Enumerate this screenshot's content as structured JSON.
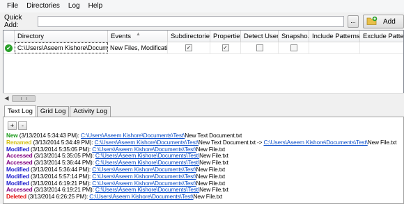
{
  "menu": [
    "File",
    "Directories",
    "Log",
    "Help"
  ],
  "quick_add": {
    "label": "Quick Add:",
    "value": "",
    "browse_label": "...",
    "add_label": "Add"
  },
  "grid": {
    "columns": [
      "Directory",
      "Events",
      "Subdirectories",
      "Properties",
      "Detect Users",
      "Snapsho...",
      "Include Patterns",
      "Exclude Patterns"
    ],
    "rows": [
      {
        "directory": "C:\\Users\\Aseem Kishore\\Docume...",
        "events": "New Files, Modificatio...",
        "subdirectories": true,
        "properties": true,
        "detect_users": false,
        "snapshot": false,
        "include": "",
        "exclude": ""
      }
    ]
  },
  "tabs": [
    "Text Log",
    "Grid Log",
    "Activity Log"
  ],
  "log_buttons": [
    "+",
    "-"
  ],
  "colors": {
    "new": "#1a9a1a",
    "renamed": "#d4c018",
    "modified": "#1a1acc",
    "accessed": "#800080",
    "deleted": "#e01010",
    "link": "#0b4ec9"
  },
  "log": [
    {
      "event": "New",
      "color": "#1a9a1a",
      "time": " (3/13/2014 5:34:43 PM): ",
      "link": "C:\\Users\\Aseem Kishore\\Documents\\Test\\",
      "rest": "New Text Document.txt",
      "link2": "",
      "rest2": ""
    },
    {
      "event": "Renamed",
      "color": "#d4c018",
      "time": " (3/13/2014 5:34:49 PM): ",
      "link": "C:\\Users\\Aseem Kishore\\Documents\\Test\\",
      "rest": "New Text Document.txt -> ",
      "link2": "C:\\Users\\Aseem Kishore\\Documents\\Test\\",
      "rest2": "New File.txt"
    },
    {
      "event": "Modified",
      "color": "#1a1acc",
      "time": " (3/13/2014 5:35:05 PM): ",
      "link": "C:\\Users\\Aseem Kishore\\Documents\\Test\\",
      "rest": "New File.txt",
      "link2": "",
      "rest2": ""
    },
    {
      "event": "Accessed",
      "color": "#800080",
      "time": " (3/13/2014 5:35:05 PM): ",
      "link": "C:\\Users\\Aseem Kishore\\Documents\\Test\\",
      "rest": "New File.txt",
      "link2": "",
      "rest2": ""
    },
    {
      "event": "Accessed",
      "color": "#800080",
      "time": " (3/13/2014 5:36:44 PM): ",
      "link": "C:\\Users\\Aseem Kishore\\Documents\\Test\\",
      "rest": "New File.txt",
      "link2": "",
      "rest2": ""
    },
    {
      "event": "Modified",
      "color": "#1a1acc",
      "time": " (3/13/2014 5:36:44 PM): ",
      "link": "C:\\Users\\Aseem Kishore\\Documents\\Test\\",
      "rest": "New File.txt",
      "link2": "",
      "rest2": ""
    },
    {
      "event": "Modified",
      "color": "#1a1acc",
      "time": " (3/13/2014 5:57:14 PM): ",
      "link": "C:\\Users\\Aseem Kishore\\Documents\\Test\\",
      "rest": "New File.txt",
      "link2": "",
      "rest2": ""
    },
    {
      "event": "Modified",
      "color": "#1a1acc",
      "time": " (3/13/2014 6:19:21 PM): ",
      "link": "C:\\Users\\Aseem Kishore\\Documents\\Test\\",
      "rest": "New File.txt",
      "link2": "",
      "rest2": ""
    },
    {
      "event": "Accessed",
      "color": "#800080",
      "time": " (3/13/2014 6:19:21 PM): ",
      "link": "C:\\Users\\Aseem Kishore\\Documents\\Test\\",
      "rest": "New File.txt",
      "link2": "",
      "rest2": ""
    },
    {
      "event": "Deleted",
      "color": "#e01010",
      "time": " (3/13/2014 6:26:25 PM): ",
      "link": "C:\\Users\\Aseem Kishore\\Documents\\Test\\",
      "rest": "New File.txt",
      "link2": "",
      "rest2": ""
    }
  ]
}
